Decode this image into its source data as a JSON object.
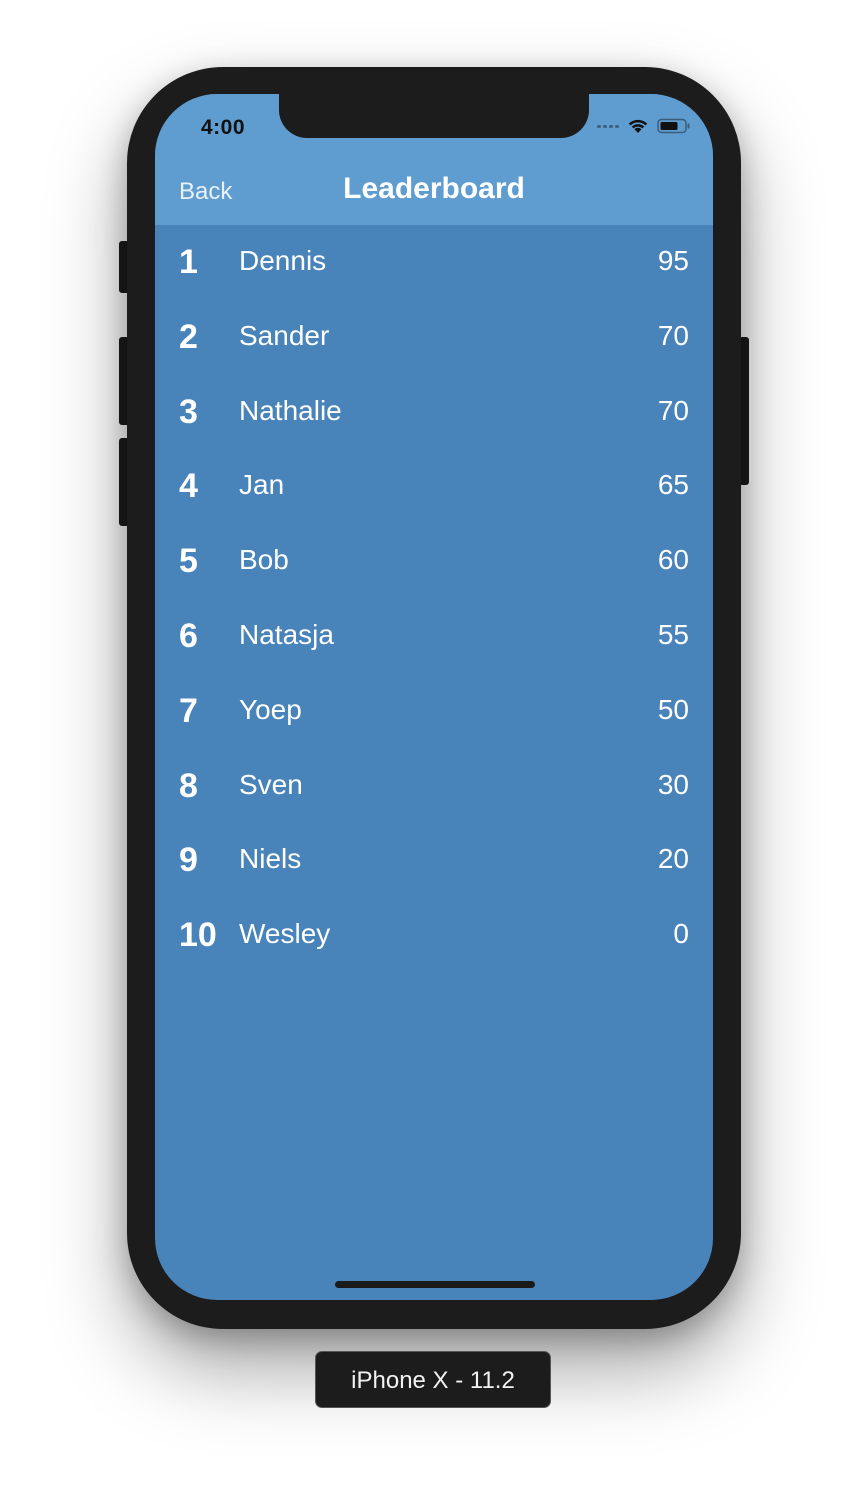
{
  "status_bar": {
    "time": "4:00"
  },
  "nav": {
    "back_label": "Back",
    "title": "Leaderboard"
  },
  "leaderboard": [
    {
      "rank": "1",
      "name": "Dennis",
      "score": "95"
    },
    {
      "rank": "2",
      "name": "Sander",
      "score": "70"
    },
    {
      "rank": "3",
      "name": "Nathalie",
      "score": "70"
    },
    {
      "rank": "4",
      "name": "Jan",
      "score": "65"
    },
    {
      "rank": "5",
      "name": "Bob",
      "score": "60"
    },
    {
      "rank": "6",
      "name": "Natasja",
      "score": "55"
    },
    {
      "rank": "7",
      "name": "Yoep",
      "score": "50"
    },
    {
      "rank": "8",
      "name": "Sven",
      "score": "30"
    },
    {
      "rank": "9",
      "name": "Niels",
      "score": "20"
    },
    {
      "rank": "10",
      "name": "Wesley",
      "score": "0"
    }
  ],
  "device_label": "iPhone X - 11.2",
  "colors": {
    "screen_background": "#4883ba",
    "nav_background": "#5f9cd0",
    "text": "#ffffff"
  },
  "icons": {
    "signal": "cellular-signal-icon",
    "wifi": "wifi-icon",
    "battery": "battery-icon"
  }
}
